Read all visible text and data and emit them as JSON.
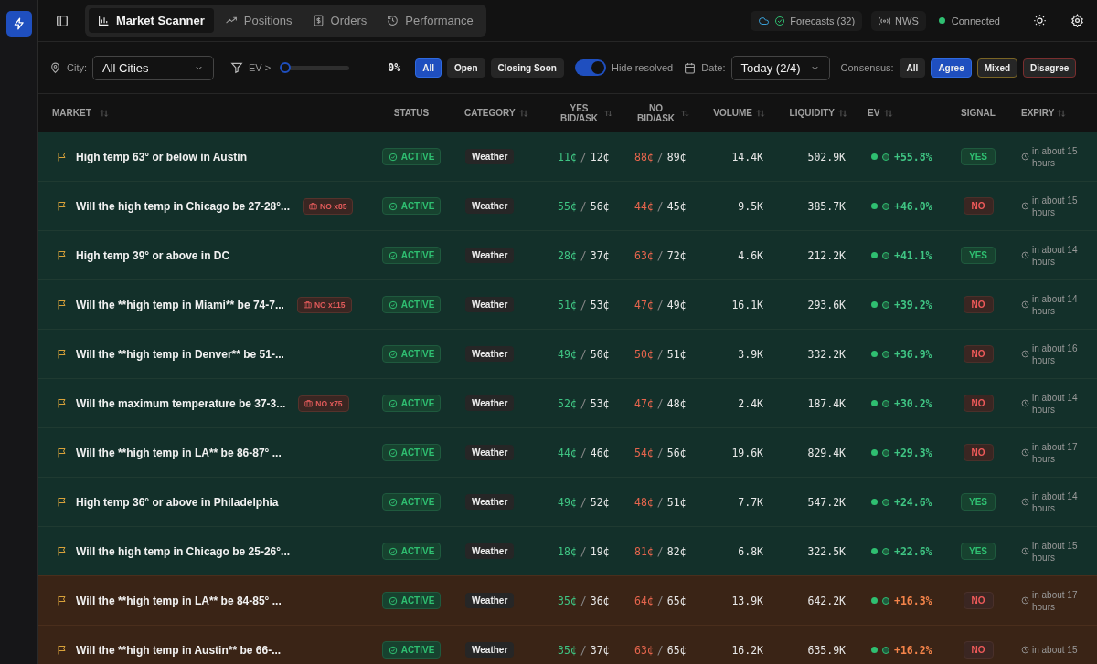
{
  "tabs": [
    {
      "label": "Market Scanner",
      "selected": true
    },
    {
      "label": "Positions",
      "selected": false
    },
    {
      "label": "Orders",
      "selected": false
    },
    {
      "label": "Performance",
      "selected": false
    }
  ],
  "status": {
    "forecasts": "Forecasts (32)",
    "source": "NWS",
    "connection": "Connected",
    "connected": true
  },
  "filters": {
    "city_label": "City:",
    "city": "All Cities",
    "ev_label": "EV >",
    "ev": {
      "level": 0,
      "reading": "0%"
    },
    "status_buttons": [
      {
        "label": "All",
        "selected": true
      },
      {
        "label": "Open",
        "selected": false
      },
      {
        "label": "Closing Soon",
        "selected": false
      }
    ],
    "hide_resolved": {
      "label": "Hide resolved",
      "on": true
    },
    "date_label": "Date:",
    "date": "Today (2/4)",
    "consensus_label": "Consensus:",
    "consensus": [
      {
        "label": "All",
        "kind": "neutral",
        "selected": false
      },
      {
        "label": "Agree",
        "kind": "agree",
        "selected": true
      },
      {
        "label": "Mixed",
        "kind": "mixed",
        "selected": false
      },
      {
        "label": "Disagree",
        "kind": "disagree",
        "selected": false
      }
    ]
  },
  "table": {
    "columns": [
      {
        "label": "MARKET",
        "sortable": true
      },
      {
        "label": "STATUS",
        "sortable": false
      },
      {
        "label": "CATEGORY",
        "sortable": true
      },
      {
        "label": "YES BID/ASK",
        "sortable": true
      },
      {
        "label": "NO BID/ASK",
        "sortable": true
      },
      {
        "label": "VOLUME",
        "sortable": true
      },
      {
        "label": "LIQUIDITY",
        "sortable": true
      },
      {
        "label": "EV",
        "sortable": true
      },
      {
        "label": "SIGNAL",
        "sortable": false
      },
      {
        "label": "EXPIRY",
        "sortable": true
      }
    ],
    "rows": [
      {
        "kind": "positive",
        "market": "High temp 63° or below in Austin",
        "status": "ACTIVE",
        "category": "Weather",
        "yes": {
          "bid": "11¢",
          "separator": "/",
          "ask": "12¢"
        },
        "no": {
          "bid": "88¢",
          "separator": "/",
          "ask": "89¢"
        },
        "volume": "14.4K",
        "liquidity": "502.9K",
        "ev": "+55.8%",
        "signal": {
          "label": "YES",
          "kind": "yes"
        },
        "expiry": "in about 15 hours"
      },
      {
        "kind": "positive",
        "market": "Will the high temp in Chicago be 27-28°...",
        "badge": "NO x85",
        "status": "ACTIVE",
        "category": "Weather",
        "yes": {
          "bid": "55¢",
          "separator": "/",
          "ask": "56¢"
        },
        "no": {
          "bid": "44¢",
          "separator": "/",
          "ask": "45¢"
        },
        "volume": "9.5K",
        "liquidity": "385.7K",
        "ev": "+46.0%",
        "signal": {
          "label": "NO",
          "kind": "no"
        },
        "expiry": "in about 15 hours"
      },
      {
        "kind": "positive",
        "market": "High temp 39° or above in DC",
        "status": "ACTIVE",
        "category": "Weather",
        "yes": {
          "bid": "28¢",
          "separator": "/",
          "ask": "37¢"
        },
        "no": {
          "bid": "63¢",
          "separator": "/",
          "ask": "72¢"
        },
        "volume": "4.6K",
        "liquidity": "212.2K",
        "ev": "+41.1%",
        "signal": {
          "label": "YES",
          "kind": "yes"
        },
        "expiry": "in about 14 hours"
      },
      {
        "kind": "positive",
        "market": "Will the **high temp in Miami** be 74-7...",
        "badge": "NO x115",
        "status": "ACTIVE",
        "category": "Weather",
        "yes": {
          "bid": "51¢",
          "separator": "/",
          "ask": "53¢"
        },
        "no": {
          "bid": "47¢",
          "separator": "/",
          "ask": "49¢"
        },
        "volume": "16.1K",
        "liquidity": "293.6K",
        "ev": "+39.2%",
        "signal": {
          "label": "NO",
          "kind": "no"
        },
        "expiry": "in about 14 hours"
      },
      {
        "kind": "positive",
        "market": "Will the **high temp in Denver** be 51-...",
        "status": "ACTIVE",
        "category": "Weather",
        "yes": {
          "bid": "49¢",
          "separator": "/",
          "ask": "50¢"
        },
        "no": {
          "bid": "50¢",
          "separator": "/",
          "ask": "51¢"
        },
        "volume": "3.9K",
        "liquidity": "332.2K",
        "ev": "+36.9%",
        "signal": {
          "label": "NO",
          "kind": "no"
        },
        "expiry": "in about 16 hours"
      },
      {
        "kind": "positive",
        "market": "Will the maximum temperature be 37-3...",
        "badge": "NO x75",
        "status": "ACTIVE",
        "category": "Weather",
        "yes": {
          "bid": "52¢",
          "separator": "/",
          "ask": "53¢"
        },
        "no": {
          "bid": "47¢",
          "separator": "/",
          "ask": "48¢"
        },
        "volume": "2.4K",
        "liquidity": "187.4K",
        "ev": "+30.2%",
        "signal": {
          "label": "NO",
          "kind": "no"
        },
        "expiry": "in about 14 hours"
      },
      {
        "kind": "positive",
        "market": "Will the **high temp in LA** be 86-87° ...",
        "status": "ACTIVE",
        "category": "Weather",
        "yes": {
          "bid": "44¢",
          "separator": "/",
          "ask": "46¢"
        },
        "no": {
          "bid": "54¢",
          "separator": "/",
          "ask": "56¢"
        },
        "volume": "19.6K",
        "liquidity": "829.4K",
        "ev": "+29.3%",
        "signal": {
          "label": "NO",
          "kind": "no"
        },
        "expiry": "in about 17 hours"
      },
      {
        "kind": "positive",
        "market": "High temp 36° or above in Philadelphia",
        "status": "ACTIVE",
        "category": "Weather",
        "yes": {
          "bid": "49¢",
          "separator": "/",
          "ask": "52¢"
        },
        "no": {
          "bid": "48¢",
          "separator": "/",
          "ask": "51¢"
        },
        "volume": "7.7K",
        "liquidity": "547.2K",
        "ev": "+24.6%",
        "signal": {
          "label": "YES",
          "kind": "yes"
        },
        "expiry": "in about 14 hours"
      },
      {
        "kind": "positive",
        "market": "Will the high temp in Chicago be 25-26°...",
        "status": "ACTIVE",
        "category": "Weather",
        "yes": {
          "bid": "18¢",
          "separator": "/",
          "ask": "19¢"
        },
        "no": {
          "bid": "81¢",
          "separator": "/",
          "ask": "82¢"
        },
        "volume": "6.8K",
        "liquidity": "322.5K",
        "ev": "+22.6%",
        "signal": {
          "label": "YES",
          "kind": "yes"
        },
        "expiry": "in about 15 hours"
      },
      {
        "kind": "caution",
        "market": "Will the **high temp in LA** be 84-85° ...",
        "status": "ACTIVE",
        "category": "Weather",
        "yes": {
          "bid": "35¢",
          "separator": "/",
          "ask": "36¢"
        },
        "no": {
          "bid": "64¢",
          "separator": "/",
          "ask": "65¢"
        },
        "volume": "13.9K",
        "liquidity": "642.2K",
        "ev": "+16.3%",
        "signal": {
          "label": "NO",
          "kind": "no"
        },
        "expiry": "in about 17 hours"
      },
      {
        "kind": "caution",
        "market": "Will the **high temp in Austin** be 66-...",
        "status": "ACTIVE",
        "category": "Weather",
        "yes": {
          "bid": "35¢",
          "separator": "/",
          "ask": "37¢"
        },
        "no": {
          "bid": "63¢",
          "separator": "/",
          "ask": "65¢"
        },
        "volume": "16.2K",
        "liquidity": "635.9K",
        "ev": "+16.2%",
        "signal": {
          "label": "NO",
          "kind": "no"
        },
        "expiry": "in about 15"
      }
    ]
  }
}
